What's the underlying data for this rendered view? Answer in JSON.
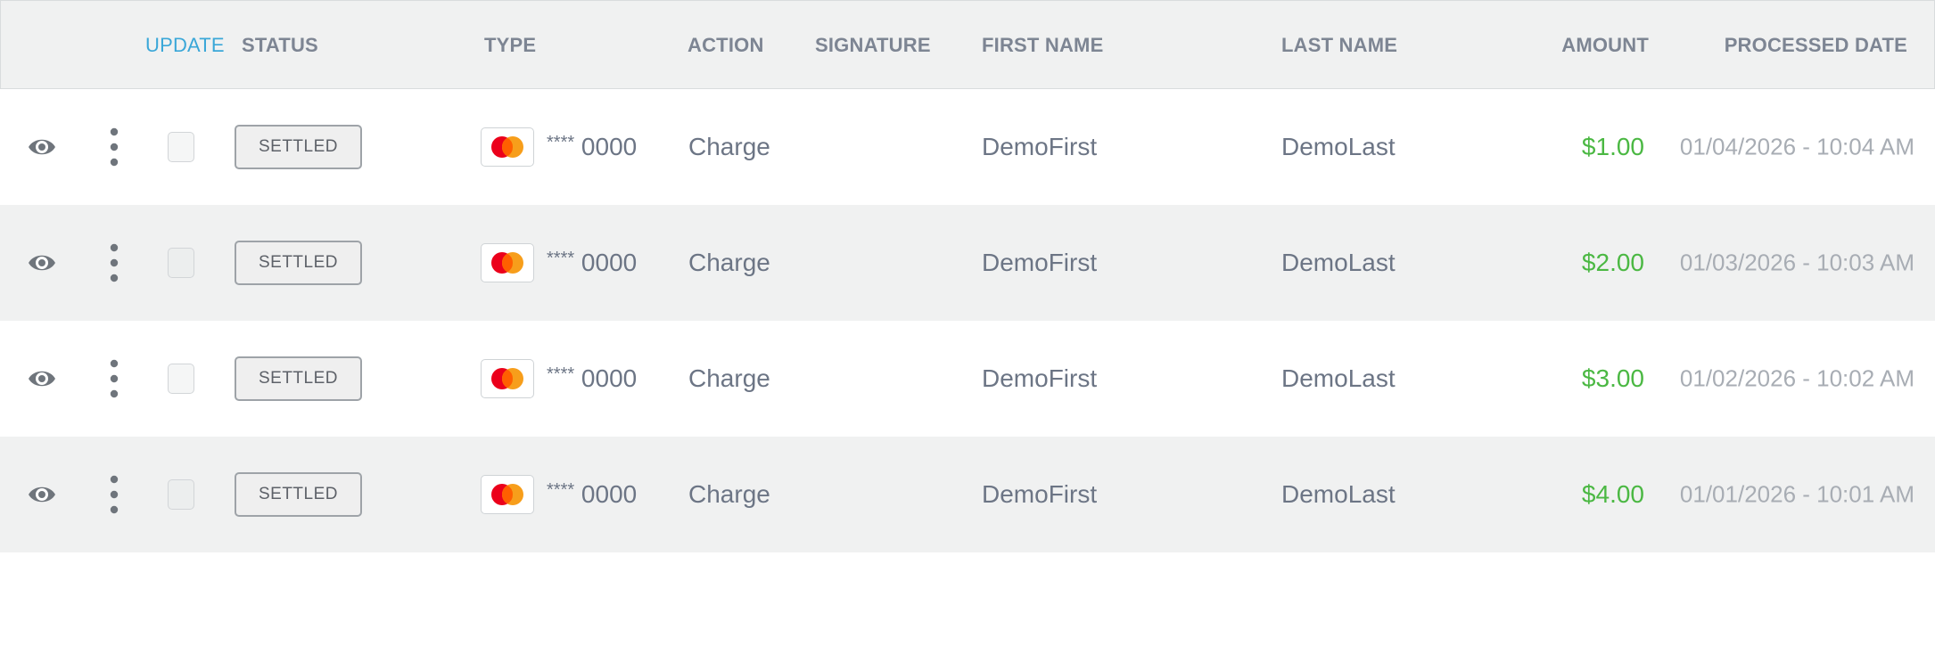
{
  "header": {
    "update": "UPDATE",
    "status": "STATUS",
    "type": "TYPE",
    "action": "ACTION",
    "signature": "SIGNATURE",
    "first_name": "FIRST NAME",
    "last_name": "LAST NAME",
    "amount": "AMOUNT",
    "processed_date": "PROCESSED DATE"
  },
  "icons": {
    "view": "eye-icon",
    "menu": "kebab-menu-icon",
    "card_brand": "mastercard-icon"
  },
  "colors": {
    "header_bg": "#f0f1f1",
    "update_link": "#3aa7d8",
    "amount_green": "#4bb843",
    "alt_row_bg": "#f0f1f1"
  },
  "rows": [
    {
      "status": "SETTLED",
      "card_stars": "****",
      "card_last4": "0000",
      "action": "Charge",
      "signature": "",
      "first_name": "DemoFirst",
      "last_name": "DemoLast",
      "amount": "$1.00",
      "processed_date": "01/04/2026 - 10:04 AM",
      "checked": false
    },
    {
      "status": "SETTLED",
      "card_stars": "****",
      "card_last4": "0000",
      "action": "Charge",
      "signature": "",
      "first_name": "DemoFirst",
      "last_name": "DemoLast",
      "amount": "$2.00",
      "processed_date": "01/03/2026 - 10:03 AM",
      "checked": false
    },
    {
      "status": "SETTLED",
      "card_stars": "****",
      "card_last4": "0000",
      "action": "Charge",
      "signature": "",
      "first_name": "DemoFirst",
      "last_name": "DemoLast",
      "amount": "$3.00",
      "processed_date": "01/02/2026 - 10:02 AM",
      "checked": false
    },
    {
      "status": "SETTLED",
      "card_stars": "****",
      "card_last4": "0000",
      "action": "Charge",
      "signature": "",
      "first_name": "DemoFirst",
      "last_name": "DemoLast",
      "amount": "$4.00",
      "processed_date": "01/01/2026 - 10:01 AM",
      "checked": false
    }
  ]
}
